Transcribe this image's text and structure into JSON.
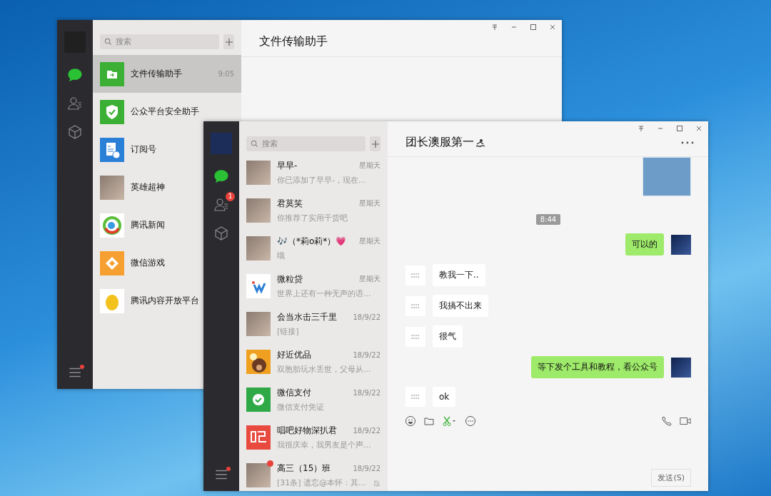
{
  "windows": [
    {
      "nav": [
        {
          "kind": "profile"
        },
        {
          "kind": "chats",
          "selected": true
        },
        {
          "kind": "contacts",
          "selected": false
        },
        {
          "kind": "favorites",
          "selected": false
        },
        {
          "kind": "menu",
          "notification": true
        }
      ],
      "search": {
        "placeholder": "搜索"
      },
      "conversations": [
        {
          "kind": "file",
          "name": "文件传输助手",
          "time": "9:05",
          "selected": true
        },
        {
          "kind": "shield",
          "name": "公众平台安全助手",
          "selected": false
        },
        {
          "kind": "doc",
          "name": "订阅号",
          "selected": false
        },
        {
          "kind": "photo",
          "name": "英雄超神",
          "selected": false
        },
        {
          "kind": "news",
          "name": "腾讯新闻",
          "selected": false
        },
        {
          "kind": "game",
          "name": "微信游戏",
          "selected": false
        },
        {
          "kind": "penguin",
          "name": "腾讯内容开放平台",
          "selected": false
        }
      ],
      "chat": {
        "title": "文件传输助手"
      }
    },
    {
      "nav": [
        {
          "kind": "profile"
        },
        {
          "kind": "chats",
          "selected": true
        },
        {
          "kind": "contacts",
          "selected": false,
          "badge": "1"
        },
        {
          "kind": "favorites",
          "selected": false
        },
        {
          "kind": "menu",
          "notification": true
        }
      ],
      "search": {
        "placeholder": "搜索"
      },
      "conversations": [
        {
          "kind": "photo",
          "name": "早早-",
          "preview": "你已添加了早早-，现在...",
          "time": "星期天",
          "selected": false,
          "unread": false,
          "muted": false
        },
        {
          "kind": "photo",
          "name": "君莫笑",
          "preview": "你推荐了实用干货吧",
          "time": "星期天",
          "selected": false,
          "unread": false,
          "muted": false
        },
        {
          "kind": "photo",
          "name": "🎶（*莉o莉*）💗",
          "preview": "哦",
          "time": "星期天",
          "selected": false,
          "unread": false,
          "muted": false
        },
        {
          "kind": "w",
          "name": "微粒贷",
          "preview": "世界上还有一种无声的语...",
          "time": "星期天",
          "selected": false,
          "unread": false,
          "muted": false
        },
        {
          "kind": "photo",
          "name": "会当水击三千里",
          "preview": "[链接]",
          "time": "18/9/22",
          "selected": false,
          "unread": false,
          "muted": false
        },
        {
          "kind": "bear",
          "name": "好近优品",
          "preview": "双胞胎玩水丢世，父母从...",
          "time": "18/9/22",
          "selected": false,
          "unread": false,
          "muted": false
        },
        {
          "kind": "pay",
          "name": "微信支付",
          "preview": "微信支付凭证",
          "time": "18/9/22",
          "selected": false,
          "unread": false,
          "muted": false
        },
        {
          "kind": "sing",
          "name": "唱吧好物深扒君",
          "preview": "我很庆幸，我男友是个声...",
          "time": "18/9/22",
          "selected": false,
          "unread": false,
          "muted": false
        },
        {
          "kind": "photo",
          "name": "高三（15）班",
          "preview": "[31条] 遗忘@本怀：其...",
          "time": "18/9/22",
          "selected": false,
          "unread": true,
          "muted": true
        }
      ],
      "chat": {
        "title": "团长澳服第一",
        "messages": [
          {
            "kind": "image",
            "outgoing": true
          },
          {
            "kind": "time",
            "text": "8:44"
          },
          {
            "kind": "text",
            "outgoing": true,
            "text": "可以的"
          },
          {
            "kind": "text",
            "outgoing": false,
            "text": "教我一下.."
          },
          {
            "kind": "text",
            "outgoing": false,
            "text": "我搞不出来"
          },
          {
            "kind": "text",
            "outgoing": false,
            "text": "很气"
          },
          {
            "kind": "text",
            "outgoing": true,
            "text": "等下发个工具和教程，看公众号"
          },
          {
            "kind": "text",
            "outgoing": false,
            "text": "ok"
          }
        ],
        "send_button": "发送(S)"
      }
    }
  ]
}
